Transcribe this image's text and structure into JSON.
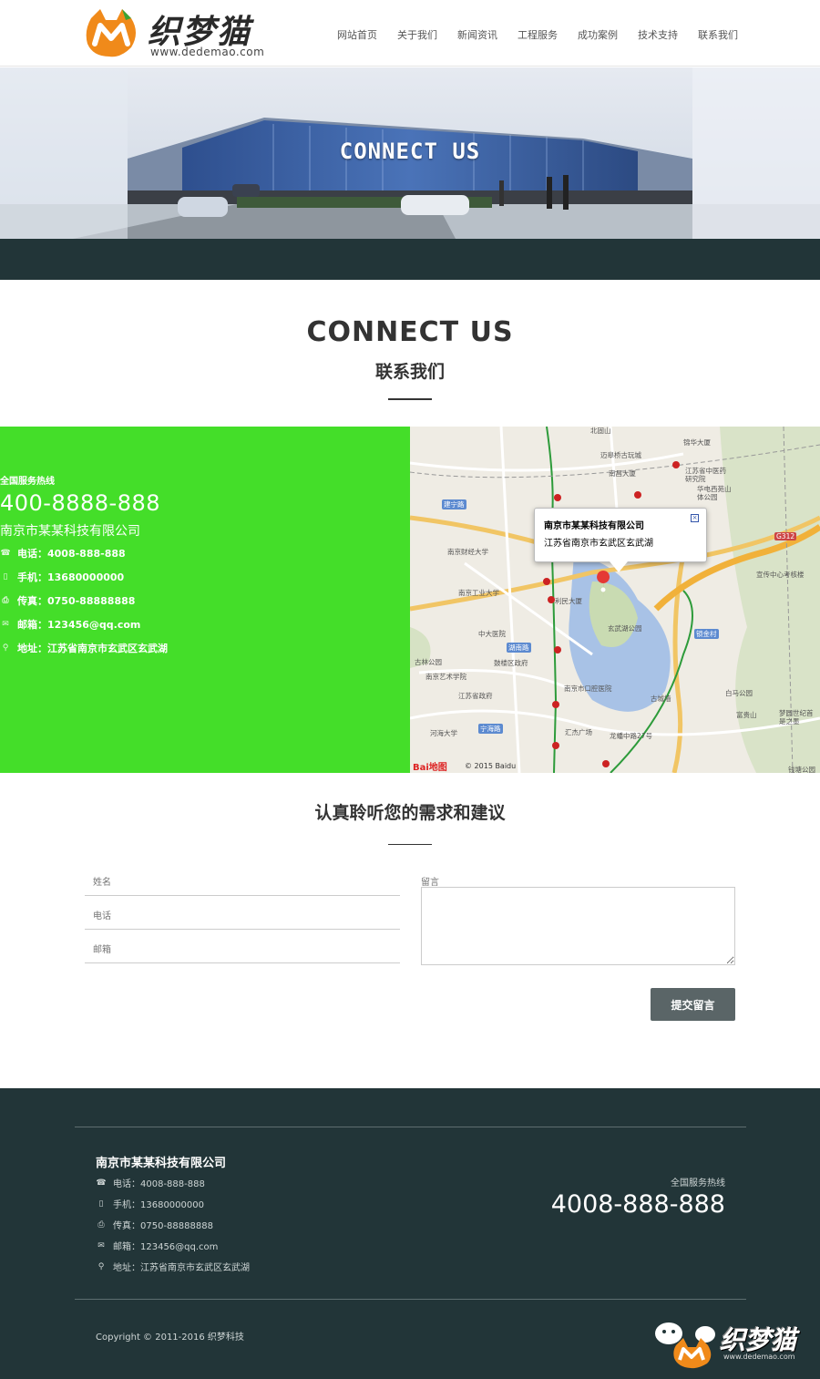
{
  "brand": {
    "name": "织梦猫",
    "url": "www.dedemao.com",
    "colors": {
      "orange": "#f08a1a",
      "green": "#44de29",
      "dark": "#223538"
    }
  },
  "nav": [
    {
      "label": "网站首页"
    },
    {
      "label": "关于我们"
    },
    {
      "label": "新闻资讯"
    },
    {
      "label": "工程服务"
    },
    {
      "label": "成功案例"
    },
    {
      "label": "技术支持"
    },
    {
      "label": "联系我们"
    }
  ],
  "banner": {
    "title": "CONNECT US"
  },
  "connect": {
    "title": "CONNECT US",
    "subtitle": "联系我们"
  },
  "contact": {
    "hotline_label": "全国服务热线",
    "hotline": "400-8888-888",
    "company": "南京市某某科技有限公司",
    "rows": [
      {
        "icon": "phone-icon",
        "text": "电话：4008-888-888"
      },
      {
        "icon": "mobile-icon",
        "text": "手机：13680000000"
      },
      {
        "icon": "fax-icon",
        "text": "传真：0750-88888888"
      },
      {
        "icon": "mail-icon",
        "text": "邮箱：123456@qq.com"
      },
      {
        "icon": "location-icon",
        "text": "地址：江苏省南京市玄武区玄武湖"
      }
    ]
  },
  "map": {
    "popup_title": "南京市某某科技有限公司",
    "popup_address": "江苏省南京市玄武区玄武湖",
    "close": "×",
    "copyright": "© 2015 Baidu",
    "baidu": "Bai地图",
    "labels": {
      "l1": "北固山",
      "l2": "锦华大厦",
      "l3": "迈皋桥古玩城",
      "l4": "南昌大厦",
      "l5": "江苏省中医药研究院",
      "l6": "华电西苑山体公园",
      "l7": "南京财经大学",
      "l8": "南京工业大学",
      "l9": "利民大厦",
      "l10": "宣传中心考核楼",
      "l11": "玄武湖公园",
      "l12": "中大医院",
      "l13": "鼓楼区政府",
      "l14": "南京艺术学院",
      "l15": "江苏省政府",
      "l16": "南京市口腔医院",
      "l17": "古城墙",
      "l18": "白马公园",
      "l19": "河海大学",
      "l20": "汇杰广场",
      "l21": "龙蟠中路27号",
      "l22": "富贵山",
      "l23": "梦圆世纪首是之墨",
      "l24": "钱塘公园",
      "l25": "古林公园"
    },
    "tags": {
      "t1": "建宁路",
      "t2": "湖南路",
      "t3": "宁海路",
      "t4": "锁金村",
      "t5": "G312"
    }
  },
  "form": {
    "title": "认真聆听您的需求和建议",
    "name_placeholder": "姓名",
    "phone_placeholder": "电话",
    "email_placeholder": "邮箱",
    "message_label": "留言",
    "submit_label": "提交留言"
  },
  "footer": {
    "company": "南京市某某科技有限公司",
    "rows": [
      {
        "icon": "phone-icon",
        "text": "电话：4008-888-888"
      },
      {
        "icon": "mobile-icon",
        "text": "手机：13680000000"
      },
      {
        "icon": "fax-icon",
        "text": "传真：0750-88888888"
      },
      {
        "icon": "mail-icon",
        "text": "邮箱：123456@qq.com"
      },
      {
        "icon": "location-icon",
        "text": "地址：江苏省南京市玄武区玄武湖"
      }
    ],
    "hotline_label": "全国服务热线",
    "hotline": "4008-888-888",
    "copyright": "Copyright © 2011-2016 织梦科技",
    "logo_text": "织梦猫",
    "logo_url": "www.dedemao.com"
  }
}
